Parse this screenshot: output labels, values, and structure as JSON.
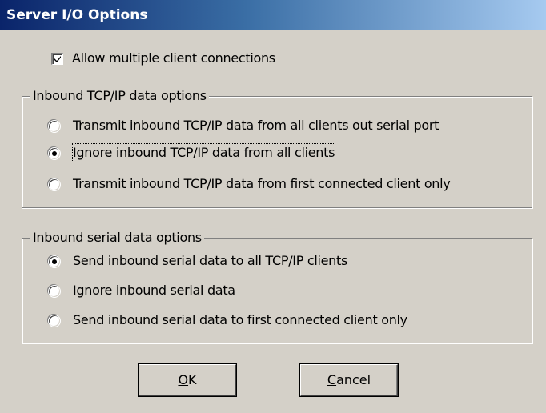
{
  "window": {
    "title": "Server I/O Options"
  },
  "multi_client": {
    "label": "Allow multiple client connections",
    "checked": true
  },
  "tcp_group": {
    "legend": "Inbound TCP/IP data options",
    "options": [
      {
        "label": "Transmit inbound TCP/IP data from all clients out serial port",
        "selected": false
      },
      {
        "label": "Ignore inbound TCP/IP data from all clients",
        "selected": true
      },
      {
        "label": "Transmit inbound TCP/IP data from first connected client only",
        "selected": false
      }
    ]
  },
  "serial_group": {
    "legend": "Inbound serial data options",
    "options": [
      {
        "label": "Send inbound serial data to all TCP/IP clients",
        "selected": true
      },
      {
        "label": "Ignore inbound serial data",
        "selected": false
      },
      {
        "label": "Send inbound serial data to first connected client only",
        "selected": false
      }
    ]
  },
  "buttons": {
    "ok_mnemonic": "O",
    "ok_rest": "K",
    "cancel_mnemonic": "C",
    "cancel_rest": "ancel"
  },
  "colors": {
    "title_start": "#0a246a",
    "title_end": "#a6caf0",
    "face": "#d4d0c8"
  }
}
